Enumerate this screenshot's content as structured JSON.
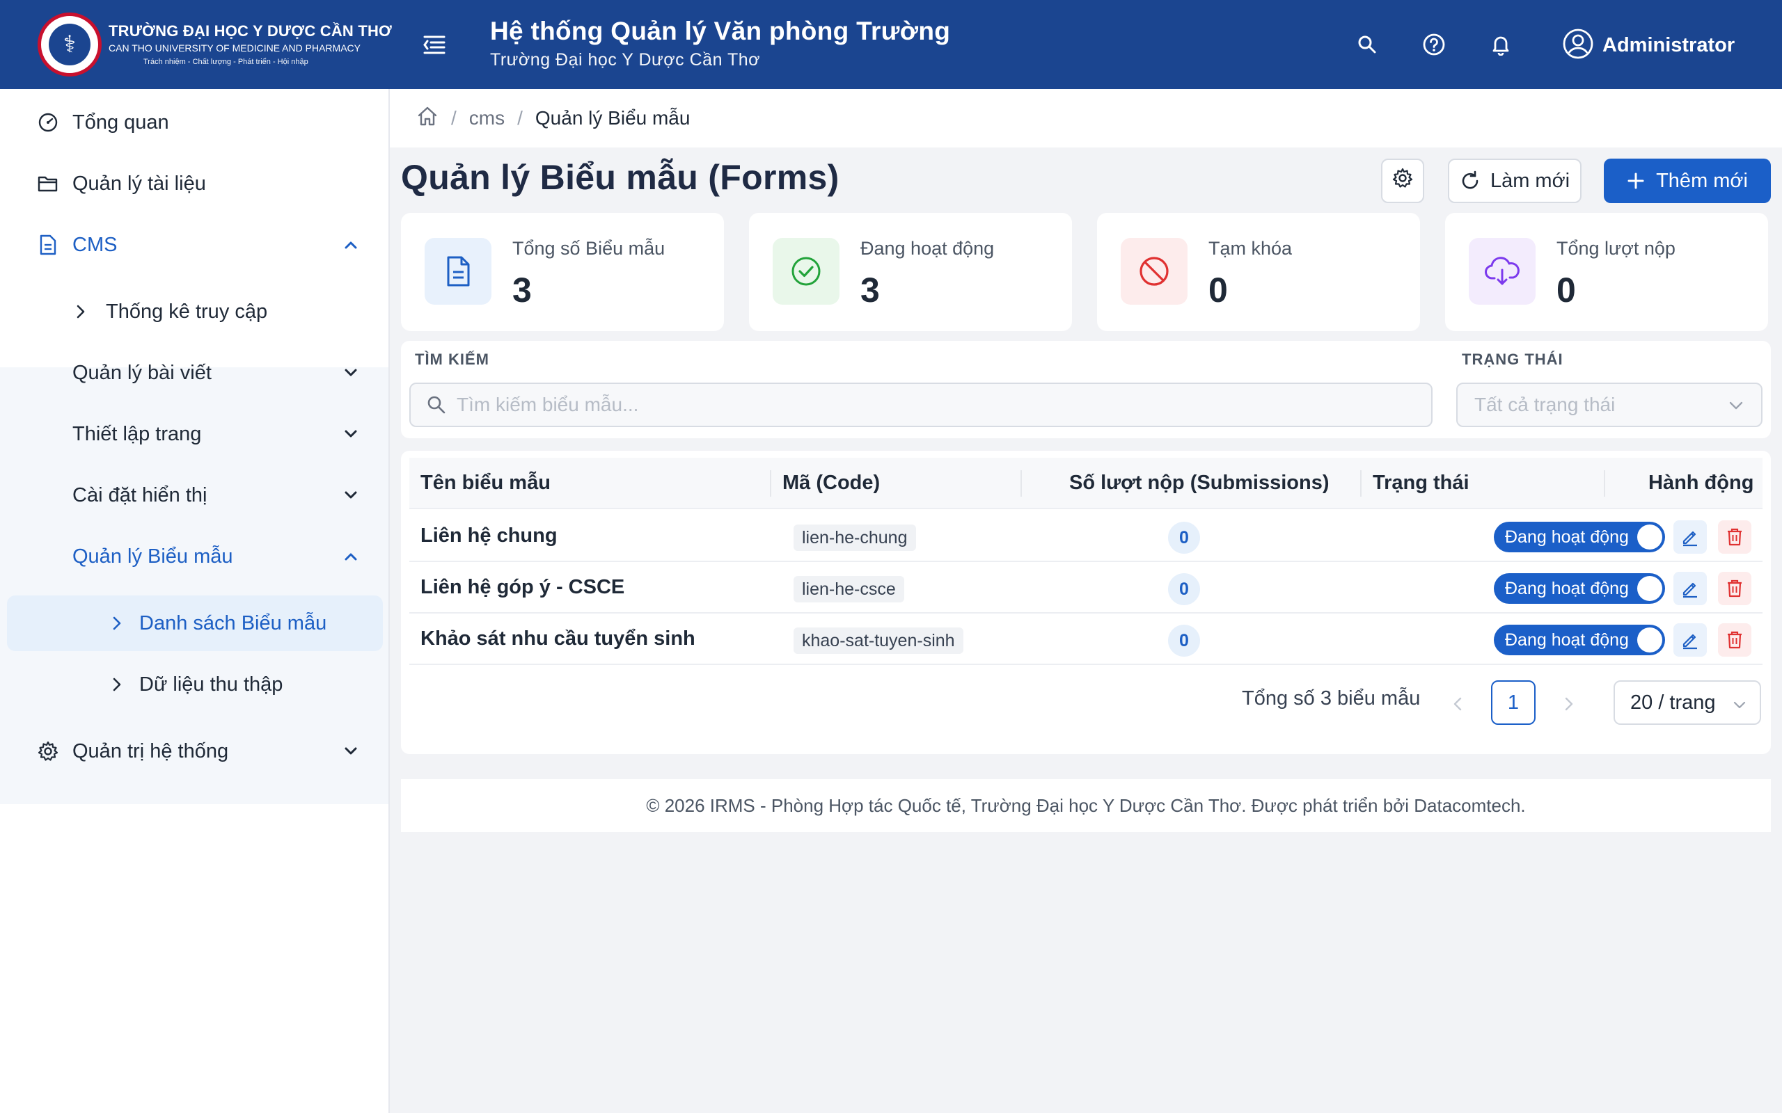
{
  "header": {
    "logo_name": "TRƯỜNG ĐẠI HỌC Y DƯỢC CẦN THƠ",
    "logo_en": "CAN THO UNIVERSITY OF MEDICINE AND PHARMACY",
    "logo_motto": "Trách nhiệm - Chất lượng - Phát triển - Hội nhập",
    "title": "Hệ thống Quản lý Văn phòng Trường",
    "subtitle": "Trường Đại học Y Dược Cần Thơ",
    "user_name": "Administrator",
    "color": "#1b4590"
  },
  "sidebar": {
    "items": [
      {
        "label": "Tổng quan",
        "icon": "dashboard-icon"
      },
      {
        "label": "Quản lý tài liệu",
        "icon": "folder-icon"
      },
      {
        "label": "CMS",
        "icon": "document-icon"
      },
      {
        "label": "Thống kê truy cập"
      },
      {
        "label": "Quản lý bài viết"
      },
      {
        "label": "Thiết lập trang"
      },
      {
        "label": "Cài đặt hiển thị"
      },
      {
        "label": "Quản lý Biểu mẫu"
      },
      {
        "label": "Danh sách Biểu mẫu"
      },
      {
        "label": "Dữ liệu thu thập"
      },
      {
        "label": "Quản trị hệ thống",
        "icon": "settings-icon"
      }
    ]
  },
  "breadcrumb": {
    "level1": "cms",
    "current": "Quản lý Biểu mẫu"
  },
  "page": {
    "title": "Quản lý Biểu mẫu (Forms)",
    "refresh_label": "Làm mới",
    "add_label": "Thêm mới"
  },
  "stats": [
    {
      "label": "Tổng số Biểu mẫu",
      "value": "3"
    },
    {
      "label": "Đang hoạt động",
      "value": "3"
    },
    {
      "label": "Tạm khóa",
      "value": "0"
    },
    {
      "label": "Tổng lượt nộp",
      "value": "0"
    }
  ],
  "filters": {
    "search_label": "TÌM KIẾM",
    "search_placeholder": "Tìm kiếm biểu mẫu...",
    "status_label": "TRẠNG THÁI",
    "status_placeholder": "Tất cả trạng thái"
  },
  "table": {
    "columns": [
      "Tên biểu mẫu",
      "Mã (Code)",
      "Số lượt nộp (Submissions)",
      "Trạng thái",
      "Hành động"
    ],
    "rows": [
      {
        "name": "Liên hệ chung",
        "code": "lien-he-chung",
        "submissions": "0",
        "status": "Đang hoạt động"
      },
      {
        "name": "Liên hệ góp ý - CSCE",
        "code": "lien-he-csce",
        "submissions": "0",
        "status": "Đang hoạt động"
      },
      {
        "name": "Khảo sát nhu cầu tuyển sinh",
        "code": "khao-sat-tuyen-sinh",
        "submissions": "0",
        "status": "Đang hoạt động"
      }
    ]
  },
  "pagination": {
    "total_text": "Tổng số 3 biểu mẫu",
    "current_page": "1",
    "page_size": "20 / trang"
  },
  "footer": {
    "text": "© 2026 IRMS - Phòng Hợp tác Quốc tế, Trường Đại học Y Dược Cần Thơ. Được phát triển bởi Datacomtech."
  }
}
